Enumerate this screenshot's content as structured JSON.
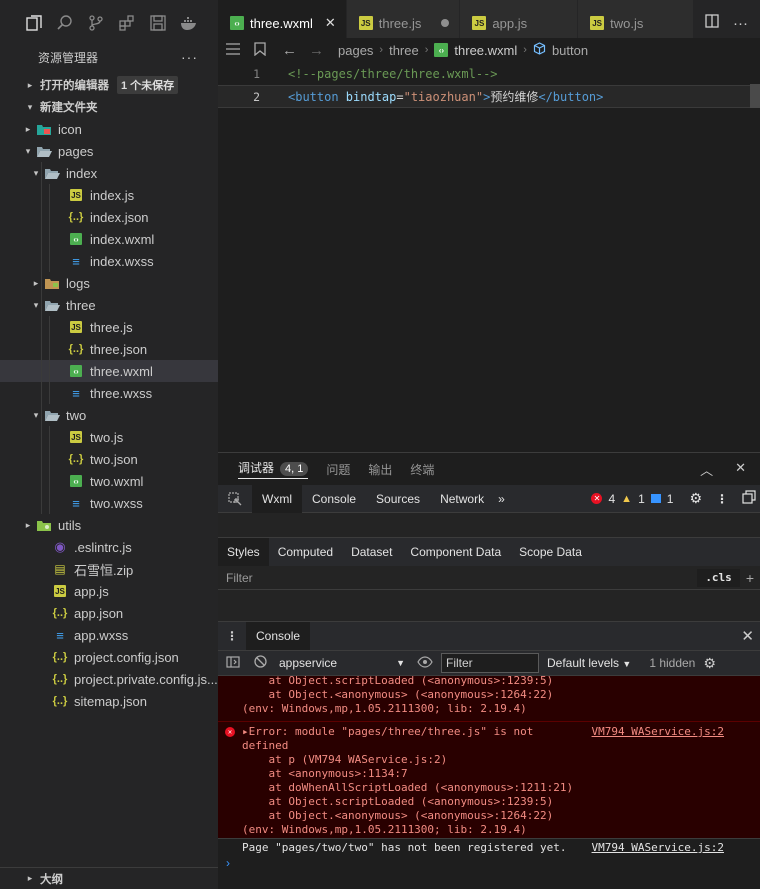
{
  "tabs": [
    {
      "label": "three.wxml",
      "icon": "wxml",
      "active": true,
      "action": "close"
    },
    {
      "label": "three.js",
      "icon": "js",
      "action": "dirty"
    },
    {
      "label": "app.js",
      "icon": "js"
    },
    {
      "label": "two.js",
      "icon": "js"
    }
  ],
  "explorer": {
    "title": "资源管理器",
    "more": "···",
    "open_editors": "打开的编辑器",
    "unsaved_badge": "1 个未保存",
    "project": "新建文件夹",
    "outline": "大纲",
    "items": [
      {
        "label": "icon",
        "kind": "folder-img",
        "depth": 1,
        "chev": "▸"
      },
      {
        "label": "pages",
        "kind": "folder-open",
        "depth": 1,
        "chev": "▾"
      },
      {
        "label": "index",
        "kind": "folder-open",
        "depth": 2,
        "chev": "▾"
      },
      {
        "label": "index.js",
        "kind": "js",
        "depth": 3
      },
      {
        "label": "index.json",
        "kind": "json",
        "depth": 3
      },
      {
        "label": "index.wxml",
        "kind": "wxml",
        "depth": 3
      },
      {
        "label": "index.wxss",
        "kind": "wxss",
        "depth": 3
      },
      {
        "label": "logs",
        "kind": "folder",
        "depth": 2,
        "chev": "▸"
      },
      {
        "label": "three",
        "kind": "folder-open",
        "depth": 2,
        "chev": "▾"
      },
      {
        "label": "three.js",
        "kind": "js",
        "depth": 3
      },
      {
        "label": "three.json",
        "kind": "json",
        "depth": 3
      },
      {
        "label": "three.wxml",
        "kind": "wxml",
        "depth": 3,
        "selected": true
      },
      {
        "label": "three.wxss",
        "kind": "wxss",
        "depth": 3
      },
      {
        "label": "two",
        "kind": "folder-open",
        "depth": 2,
        "chev": "▾"
      },
      {
        "label": "two.js",
        "kind": "js",
        "depth": 3
      },
      {
        "label": "two.json",
        "kind": "json",
        "depth": 3
      },
      {
        "label": "two.wxml",
        "kind": "wxml",
        "depth": 3
      },
      {
        "label": "two.wxss",
        "kind": "wxss",
        "depth": 3
      },
      {
        "label": "utils",
        "kind": "folder-util",
        "depth": 1,
        "chev": "▸"
      },
      {
        "label": ".eslintrc.js",
        "kind": "eslint",
        "depth": 1
      },
      {
        "label": "石雪恒.zip",
        "kind": "zip",
        "depth": 1
      },
      {
        "label": "app.js",
        "kind": "js",
        "depth": 1
      },
      {
        "label": "app.json",
        "kind": "json",
        "depth": 1
      },
      {
        "label": "app.wxss",
        "kind": "wxss",
        "depth": 1
      },
      {
        "label": "project.config.json",
        "kind": "json",
        "depth": 1
      },
      {
        "label": "project.private.config.js...",
        "kind": "json",
        "depth": 1
      },
      {
        "label": "sitemap.json",
        "kind": "json",
        "depth": 1
      }
    ]
  },
  "breadcrumb": {
    "parts": [
      "pages",
      "three",
      "three.wxml",
      "button"
    ]
  },
  "editor": {
    "lines": [
      {
        "n": "1",
        "tokens": [
          {
            "t": "<!--pages/three/three.wxml-->",
            "c": "comment"
          }
        ]
      },
      {
        "n": "2",
        "cur": true,
        "tokens": [
          {
            "t": "<button",
            "c": "tag"
          },
          {
            "t": " bindtap",
            "c": "attr"
          },
          {
            "t": "=",
            "c": "txt"
          },
          {
            "t": "\"tiaozhuan\"",
            "c": "str"
          },
          {
            "t": ">",
            "c": "tag"
          },
          {
            "t": "预约维修",
            "c": "txt"
          },
          {
            "t": "</button>",
            "c": "tag"
          }
        ]
      }
    ]
  },
  "panel": {
    "tabs": [
      "调试器",
      "问题",
      "输出",
      "终端"
    ],
    "debugger_badge": "4, 1",
    "devtools_tabs": [
      "Wxml",
      "Console",
      "Sources",
      "Network"
    ],
    "more_tabs": "»",
    "counts": {
      "errors": "4",
      "warnings": "1",
      "info": "1"
    },
    "style_tabs": [
      "Styles",
      "Computed",
      "Dataset",
      "Component Data",
      "Scope Data"
    ],
    "filter_label": "Filter",
    "cls_label": ".cls",
    "plus": "+",
    "drawer_tab": "Console",
    "context": "appservice",
    "console_filter": "Filter",
    "levels": "Default levels",
    "hidden": "1 hidden",
    "log_top": [
      "    at Object.scriptLoaded (<anonymous>:1239:5)",
      "    at Object.<anonymous> (<anonymous>:1264:22)",
      "(env: Windows,mp,1.05.2111300; lib: 2.19.4)"
    ],
    "error": {
      "head": "▸Error: module \"pages/three/three.js\" is not",
      "head2": "defined",
      "src": "VM794 WAService.js:2",
      "stack": [
        "    at p (VM794 WAService.js:2)",
        "    at <anonymous>:1134:7",
        "    at doWhenAllScriptLoaded (<anonymous>:1211:21)",
        "    at Object.scriptLoaded (<anonymous>:1239:5)",
        "    at Object.<anonymous> (<anonymous>:1264:22)",
        "(env: Windows,mp,1.05.2111300; lib: 2.19.4)"
      ]
    },
    "warning": {
      "text": "Page \"pages/two/two\" has not been registered yet.",
      "src": "VM794 WAService.js:2"
    },
    "prompt": "›"
  }
}
